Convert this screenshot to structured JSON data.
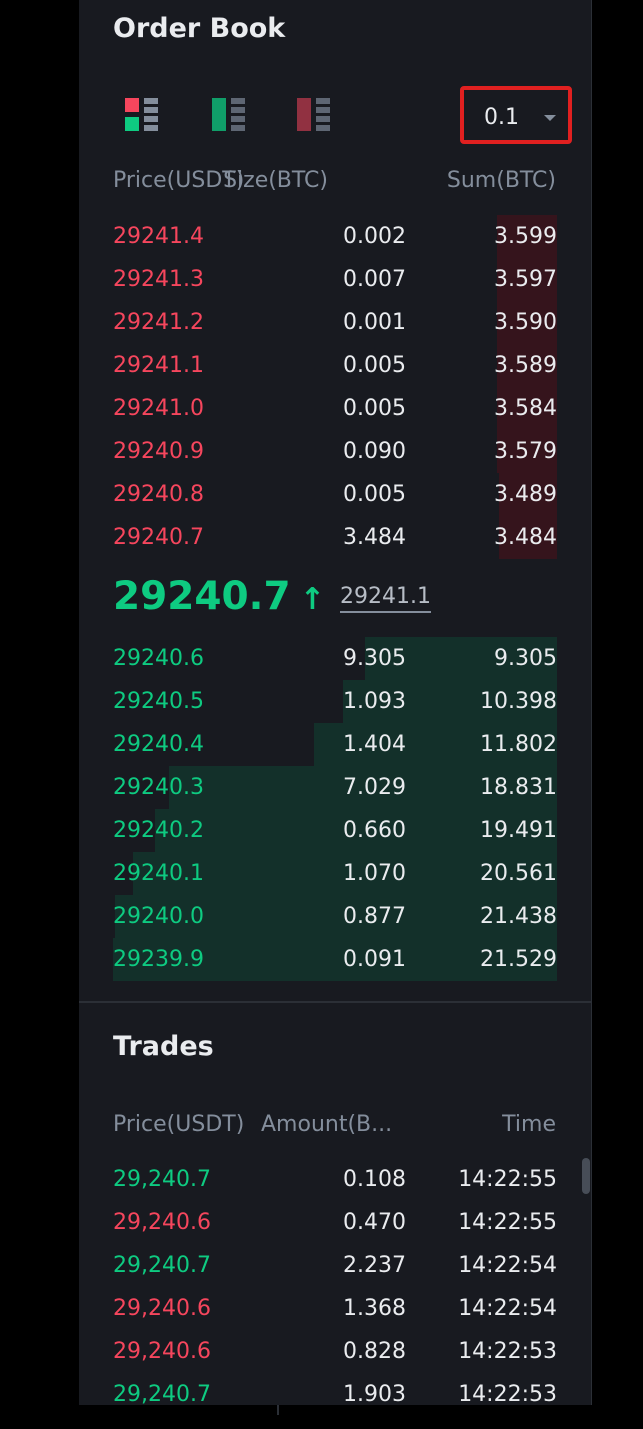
{
  "order_book": {
    "title": "Order Book",
    "precision": "0.1",
    "columns": {
      "price": "Price(USDT)",
      "size": "Size(BTC)",
      "sum": "Sum(BTC)"
    },
    "asks": [
      {
        "price": "29241.4",
        "size": "0.002",
        "sum": "3.599"
      },
      {
        "price": "29241.3",
        "size": "0.007",
        "sum": "3.597"
      },
      {
        "price": "29241.2",
        "size": "0.001",
        "sum": "3.590"
      },
      {
        "price": "29241.1",
        "size": "0.005",
        "sum": "3.589"
      },
      {
        "price": "29241.0",
        "size": "0.005",
        "sum": "3.584"
      },
      {
        "price": "29240.9",
        "size": "0.090",
        "sum": "3.579"
      },
      {
        "price": "29240.8",
        "size": "0.005",
        "sum": "3.489"
      },
      {
        "price": "29240.7",
        "size": "3.484",
        "sum": "3.484"
      }
    ],
    "last_price": "29240.7",
    "last_price_arrow": "↑",
    "mark_price": "29241.1",
    "bids": [
      {
        "price": "29240.6",
        "size": "9.305",
        "sum": "9.305"
      },
      {
        "price": "29240.5",
        "size": "1.093",
        "sum": "10.398"
      },
      {
        "price": "29240.4",
        "size": "1.404",
        "sum": "11.802"
      },
      {
        "price": "29240.3",
        "size": "7.029",
        "sum": "18.831"
      },
      {
        "price": "29240.2",
        "size": "0.660",
        "sum": "19.491"
      },
      {
        "price": "29240.1",
        "size": "1.070",
        "sum": "20.561"
      },
      {
        "price": "29240.0",
        "size": "0.877",
        "sum": "21.438"
      },
      {
        "price": "29239.9",
        "size": "0.091",
        "sum": "21.529"
      }
    ]
  },
  "trades": {
    "title": "Trades",
    "columns": {
      "price": "Price(USDT)",
      "amount": "Amount(B...",
      "time": "Time"
    },
    "rows": [
      {
        "price": "29,240.7",
        "amount": "0.108",
        "time": "14:22:55",
        "side": "buy"
      },
      {
        "price": "29,240.6",
        "amount": "0.470",
        "time": "14:22:55",
        "side": "sell"
      },
      {
        "price": "29,240.7",
        "amount": "2.237",
        "time": "14:22:54",
        "side": "buy"
      },
      {
        "price": "29,240.6",
        "amount": "1.368",
        "time": "14:22:54",
        "side": "sell"
      },
      {
        "price": "29,240.6",
        "amount": "0.828",
        "time": "14:22:53",
        "side": "sell"
      },
      {
        "price": "29,240.7",
        "amount": "1.903",
        "time": "14:22:53",
        "side": "buy"
      }
    ]
  },
  "icons": {
    "view_both": "order-book-both-icon",
    "view_bids": "order-book-bids-icon",
    "view_asks": "order-book-asks-icon",
    "caret": "caret-down-icon",
    "arrow_up": "arrow-up-icon"
  },
  "colors": {
    "ask": "#f6465d",
    "bid": "#0ecb81",
    "ask_depth_bg": "#35141c",
    "bid_depth_bg": "#13302a",
    "panel_bg": "#181a20",
    "highlight_box": "#e02020"
  }
}
